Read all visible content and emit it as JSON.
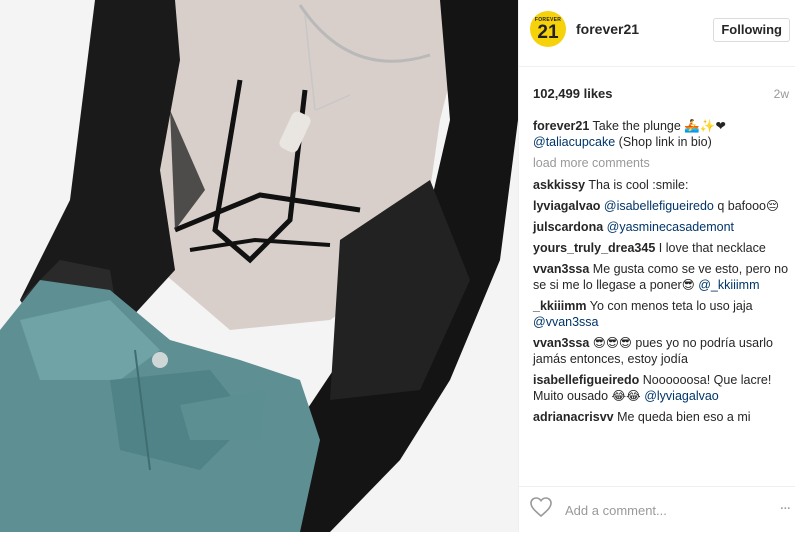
{
  "post": {
    "username": "forever21",
    "avatar_text_top": "FOREVER",
    "avatar_text_num": "21",
    "follow_label": "Following",
    "likes": "102,499 likes",
    "time": "2w",
    "caption_user": "forever21",
    "caption_text": "Take the plunge 🚣✨❤",
    "caption_mention": "@taliacupcake",
    "caption_suffix": "(Shop link in bio)",
    "load_more": "load more comments",
    "comments": [
      {
        "user": "askkissy",
        "parts": [
          {
            "t": "Tha is cool :smile:"
          }
        ]
      },
      {
        "user": "lyviagalvao",
        "parts": [
          {
            "m": "@isabellefigueiredo"
          },
          {
            "t": " q bafooo😔"
          }
        ]
      },
      {
        "user": "julscardona",
        "parts": [
          {
            "m": "@yasminecasademont"
          }
        ]
      },
      {
        "user": "yours_truly_drea345",
        "parts": [
          {
            "t": "I love that necklace"
          }
        ]
      },
      {
        "user": "vvan3ssa",
        "parts": [
          {
            "t": "Me gusta como se ve esto, pero no se si me lo llegase a poner😎 "
          },
          {
            "m": "@_kkiiimm"
          }
        ]
      },
      {
        "user": "_kkiiimm",
        "parts": [
          {
            "t": "Yo con menos teta lo uso jaja "
          },
          {
            "m": "@vvan3ssa"
          }
        ]
      },
      {
        "user": "vvan3ssa",
        "parts": [
          {
            "t": "😎😎😎 pues yo no podría usarlo jamás entonces, estoy jodía"
          }
        ]
      },
      {
        "user": "isabellefigueiredo",
        "parts": [
          {
            "t": "Noooooosa! Que lacre! Muito ousado 😂😂 "
          },
          {
            "m": "@lyviagalvao"
          }
        ]
      },
      {
        "user": "adrianacrisvv",
        "parts": [
          {
            "t": "Me queda bien eso a mi"
          }
        ]
      }
    ],
    "comment_placeholder": "Add a comment...",
    "more_label": "...",
    "colors": {
      "avatar_bg": "#f5d20a",
      "mention": "#003569",
      "muted": "#999999"
    }
  }
}
